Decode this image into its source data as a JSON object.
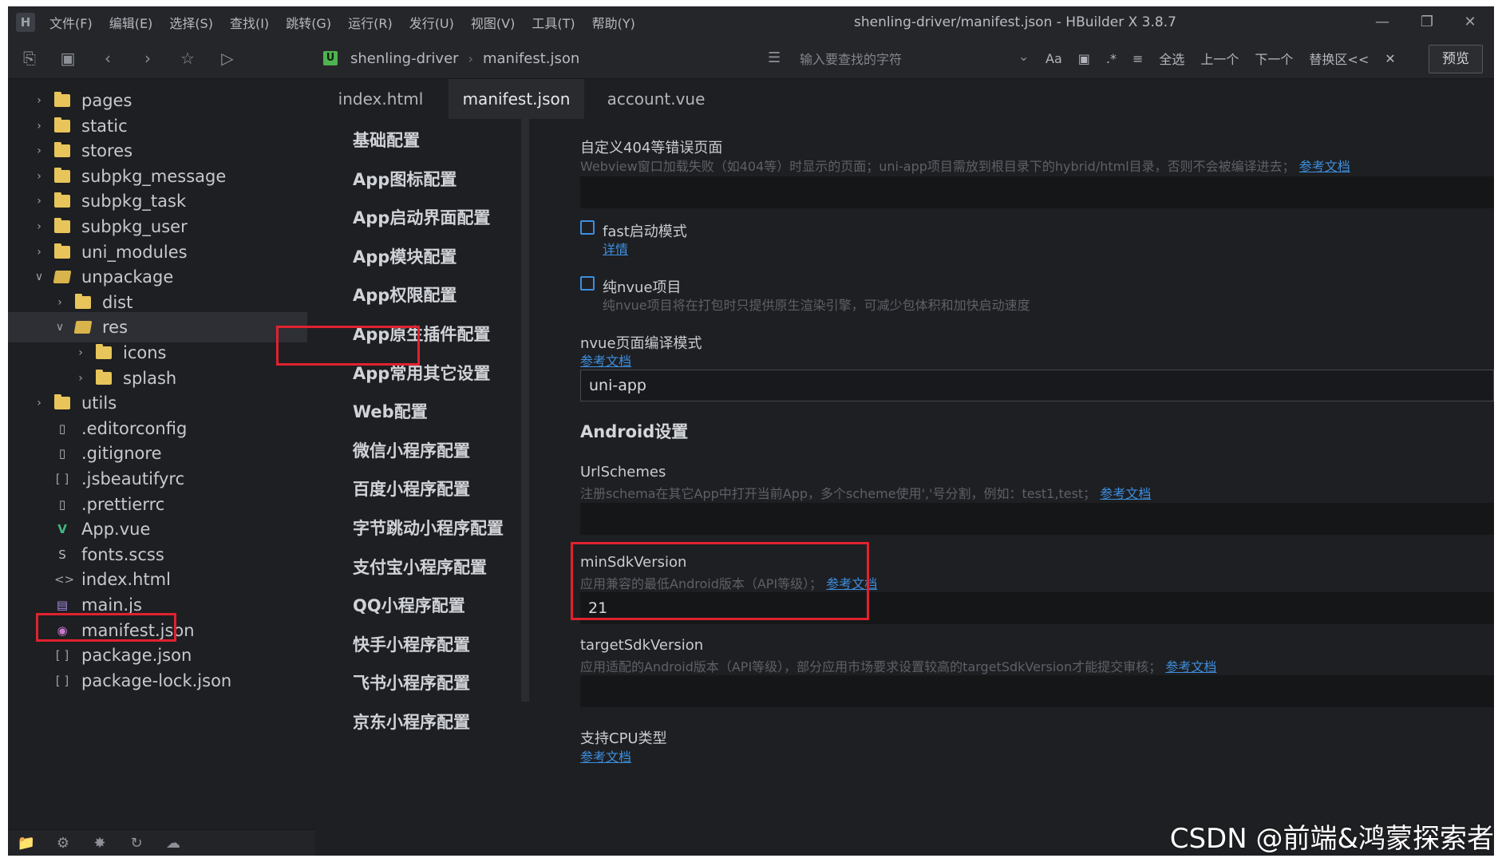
{
  "menubar": {
    "items": [
      "文件(F)",
      "编辑(E)",
      "选择(S)",
      "查找(I)",
      "跳转(G)",
      "运行(R)",
      "发行(U)",
      "视图(V)",
      "工具(T)",
      "帮助(Y)"
    ],
    "title": "shenling-driver/manifest.json - HBuilder X 3.8.7",
    "logo": "H"
  },
  "toolbar": {
    "breadcrumb": {
      "badge": "U",
      "project": "shenling-driver",
      "file": "manifest.json"
    },
    "search_placeholder": "输入要查找的字符",
    "find_tools": [
      "Aa",
      "全选",
      "上一个",
      "下一个",
      "替换区<<"
    ],
    "preview_label": "预览"
  },
  "file_tree": [
    {
      "label": "pages",
      "type": "folder",
      "depth": 0,
      "expanded": false
    },
    {
      "label": "static",
      "type": "folder",
      "depth": 0,
      "expanded": false
    },
    {
      "label": "stores",
      "type": "folder",
      "depth": 0,
      "expanded": false
    },
    {
      "label": "subpkg_message",
      "type": "folder",
      "depth": 0,
      "expanded": false
    },
    {
      "label": "subpkg_task",
      "type": "folder",
      "depth": 0,
      "expanded": false
    },
    {
      "label": "subpkg_user",
      "type": "folder",
      "depth": 0,
      "expanded": false
    },
    {
      "label": "uni_modules",
      "type": "folder",
      "depth": 0,
      "expanded": false
    },
    {
      "label": "unpackage",
      "type": "folder",
      "depth": 0,
      "expanded": true
    },
    {
      "label": "dist",
      "type": "folder",
      "depth": 1,
      "expanded": false
    },
    {
      "label": "res",
      "type": "folder",
      "depth": 1,
      "expanded": true,
      "selected": true
    },
    {
      "label": "icons",
      "type": "folder",
      "depth": 2,
      "expanded": false
    },
    {
      "label": "splash",
      "type": "folder",
      "depth": 2,
      "expanded": false
    },
    {
      "label": "utils",
      "type": "folder",
      "depth": 0,
      "expanded": false
    },
    {
      "label": ".editorconfig",
      "type": "file",
      "depth": 0
    },
    {
      "label": ".gitignore",
      "type": "file",
      "depth": 0
    },
    {
      "label": ".jsbeautifyrc",
      "type": "brace",
      "depth": 0
    },
    {
      "label": ".prettierrc",
      "type": "file",
      "depth": 0
    },
    {
      "label": "App.vue",
      "type": "vue",
      "depth": 0
    },
    {
      "label": "fonts.scss",
      "type": "scss",
      "depth": 0
    },
    {
      "label": "index.html",
      "type": "html",
      "depth": 0
    },
    {
      "label": "main.js",
      "type": "js",
      "depth": 0
    },
    {
      "label": "manifest.json",
      "type": "manifest",
      "depth": 0,
      "highlighted": true
    },
    {
      "label": "package.json",
      "type": "brace",
      "depth": 0
    },
    {
      "label": "package-lock.json",
      "type": "brace",
      "depth": 0
    }
  ],
  "tabs": [
    {
      "label": "index.html",
      "active": false
    },
    {
      "label": "manifest.json",
      "active": true
    },
    {
      "label": "account.vue",
      "active": false
    }
  ],
  "config_nav": [
    "基础配置",
    "App图标配置",
    "App启动界面配置",
    "App模块配置",
    "App权限配置",
    "App原生插件配置",
    "App常用其它设置",
    "Web配置",
    "微信小程序配置",
    "百度小程序配置",
    "字节跳动小程序配置",
    "支付宝小程序配置",
    "QQ小程序配置",
    "快手小程序配置",
    "飞书小程序配置",
    "京东小程序配置"
  ],
  "config_nav_highlighted": "App常用其它设置",
  "content": {
    "error_page": {
      "label": "自定义404等错误页面",
      "desc": "Webview窗口加载失败（如404等）时显示的页面；uni-app项目需放到根目录下的hybrid/html目录，否则不会被编译进去；",
      "link": "参考文档",
      "value": ""
    },
    "fast_start": {
      "label": "fast启动模式",
      "link": "详情",
      "checked": false
    },
    "pure_nvue": {
      "label": "纯nvue项目",
      "desc": "纯nvue项目将在打包时只提供原生渲染引擎，可减少包体积和加快启动速度",
      "checked": false
    },
    "nvue_compile": {
      "label": "nvue页面编译模式",
      "link": "参考文档",
      "value": "uni-app"
    },
    "android_title": "Android设置",
    "url_schemes": {
      "label": "UrlSchemes",
      "desc": "注册schema在其它App中打开当前App，多个scheme使用','号分割，例如：test1,test；",
      "link": "参考文档",
      "value": ""
    },
    "min_sdk": {
      "label": "minSdkVersion",
      "desc": "应用兼容的最低Android版本（API等级）；",
      "link": "参考文档",
      "value": "21"
    },
    "target_sdk": {
      "label": "targetSdkVersion",
      "desc": "应用适配的Android版本（API等级），部分应用市场要求设置较高的targetSdkVersion才能提交审核；",
      "link": "参考文档",
      "value": ""
    },
    "cpu_type": {
      "label": "支持CPU类型",
      "link": "参考文档"
    }
  },
  "watermark": "CSDN @前端&鸿蒙探索者",
  "colors": {
    "accent": "#3d8fe0",
    "highlight": "#e0222e",
    "background": "#1e1f22",
    "folder": "#e8c55a"
  }
}
